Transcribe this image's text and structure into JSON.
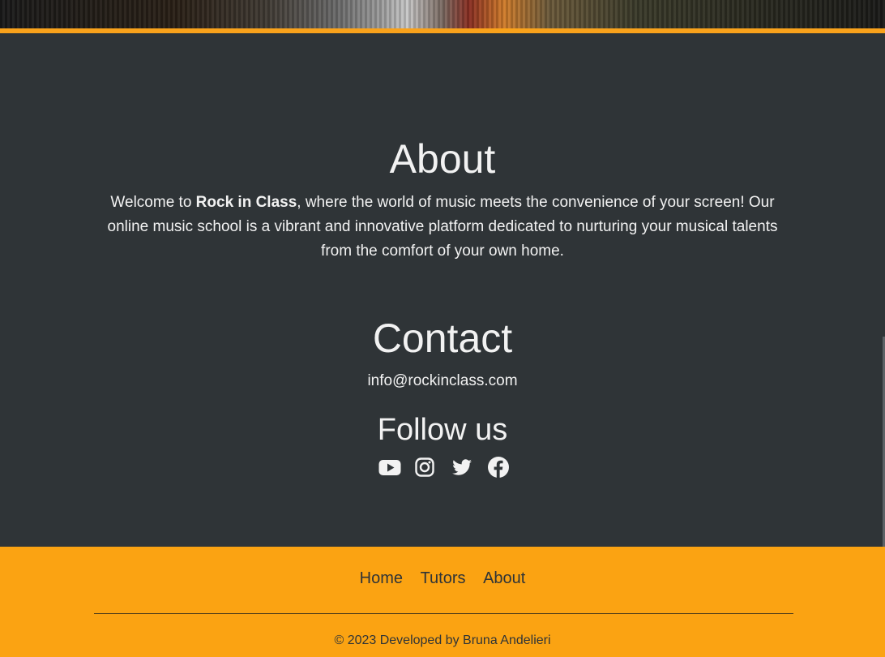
{
  "about": {
    "title": "About",
    "text_before": "Welcome to ",
    "brand": "Rock in Class",
    "text_after": ", where the world of music meets the convenience of your screen! Our online music school is a vibrant and innovative platform dedicated to nurturing your musical talents from the comfort of your own home."
  },
  "contact": {
    "title": "Contact",
    "email": "info@rockinclass.com"
  },
  "follow": {
    "title": "Follow us",
    "icons": [
      "youtube-icon",
      "instagram-icon",
      "twitter-icon",
      "facebook-icon"
    ]
  },
  "footer": {
    "nav": [
      "Home",
      "Tutors",
      "About"
    ],
    "copyright": "© 2023 Developed by Bruna Andelieri"
  },
  "colors": {
    "background": "#2f3437",
    "accent": "#fba312",
    "text": "#f2f2f2"
  }
}
